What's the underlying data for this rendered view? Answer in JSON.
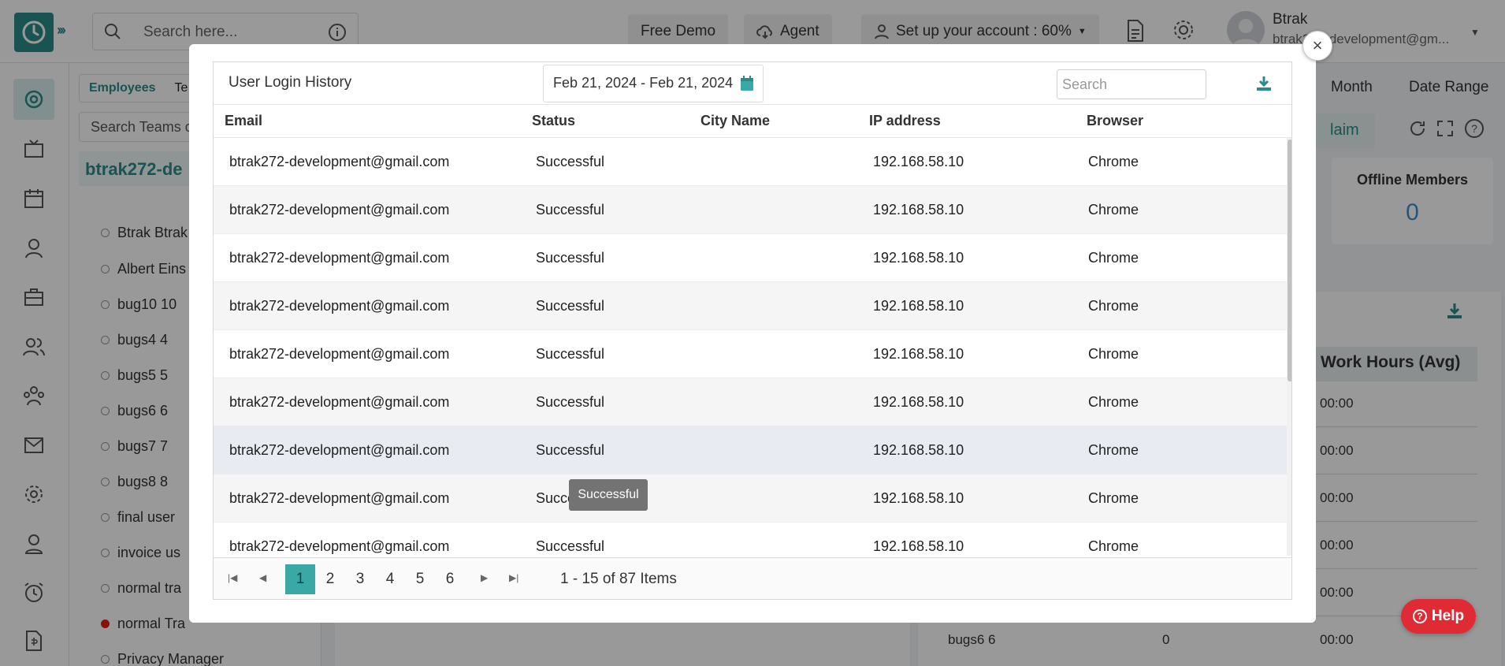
{
  "header": {
    "search_placeholder": "Search here...",
    "free_demo": "Free Demo",
    "agent": "Agent",
    "setup": "Set up your account : 60%",
    "user_name": "Btrak",
    "user_email": "btrak272-development@gm..."
  },
  "employees": {
    "tab_employees": "Employees",
    "tab_teams": "Te",
    "search_placeholder": "Search Teams o",
    "team_name": "btrak272-de",
    "items": [
      {
        "name": "Btrak Btrak"
      },
      {
        "name": "Albert Eins"
      },
      {
        "name": "bug10 10"
      },
      {
        "name": "bugs4 4"
      },
      {
        "name": "bugs5 5"
      },
      {
        "name": "bugs6 6"
      },
      {
        "name": "bugs7 7"
      },
      {
        "name": "bugs8 8"
      },
      {
        "name": "final user"
      },
      {
        "name": "invoice us"
      },
      {
        "name": "normal tra"
      },
      {
        "name": "normal Tra"
      },
      {
        "name": "Privacy Manager"
      }
    ]
  },
  "right_panel": {
    "tab_month": "Month",
    "tab_date_range": "Date Range",
    "claim": "laim",
    "offline_title": "Offline Members",
    "offline_value": "0",
    "work_hours_header": "Work Hours (Avg)",
    "times": [
      "00:00",
      "00:00",
      "00:00",
      "00:00",
      "00:00",
      "00:00"
    ],
    "last_row_name": "bugs6 6",
    "last_row_value": "0"
  },
  "help": {
    "label": "Help"
  },
  "modal": {
    "title": "User Login History",
    "date_range": "Feb 21, 2024 - Feb 21, 2024",
    "search_placeholder": "Search",
    "columns": {
      "email": "Email",
      "status": "Status",
      "city": "City Name",
      "ip": "IP address",
      "browser": "Browser"
    },
    "rows": [
      {
        "email": "btrak272-development@gmail.com",
        "status": "Successful",
        "city": "",
        "ip": "192.168.58.10",
        "browser": "Chrome"
      },
      {
        "email": "btrak272-development@gmail.com",
        "status": "Successful",
        "city": "",
        "ip": "192.168.58.10",
        "browser": "Chrome"
      },
      {
        "email": "btrak272-development@gmail.com",
        "status": "Successful",
        "city": "",
        "ip": "192.168.58.10",
        "browser": "Chrome"
      },
      {
        "email": "btrak272-development@gmail.com",
        "status": "Successful",
        "city": "",
        "ip": "192.168.58.10",
        "browser": "Chrome"
      },
      {
        "email": "btrak272-development@gmail.com",
        "status": "Successful",
        "city": "",
        "ip": "192.168.58.10",
        "browser": "Chrome"
      },
      {
        "email": "btrak272-development@gmail.com",
        "status": "Successful",
        "city": "",
        "ip": "192.168.58.10",
        "browser": "Chrome"
      },
      {
        "email": "btrak272-development@gmail.com",
        "status": "Successful",
        "city": "",
        "ip": "192.168.58.10",
        "browser": "Chrome"
      },
      {
        "email": "btrak272-development@gmail.com",
        "status": "Successful",
        "city": "",
        "ip": "192.168.58.10",
        "browser": "Chrome"
      },
      {
        "email": "btrak272-development@gmail.com",
        "status": "Successful",
        "city": "",
        "ip": "192.168.58.10",
        "browser": "Chrome"
      }
    ],
    "tooltip": "Successful",
    "pager": {
      "pages": [
        "1",
        "2",
        "3",
        "4",
        "5",
        "6"
      ],
      "current": "1",
      "info": "1 - 15 of 87 Items"
    }
  },
  "colors": {
    "accent": "#2a8c8a",
    "current_page": "#3aa9a6",
    "help_red": "#e02b35",
    "offline_blue": "#3a8fd0"
  }
}
